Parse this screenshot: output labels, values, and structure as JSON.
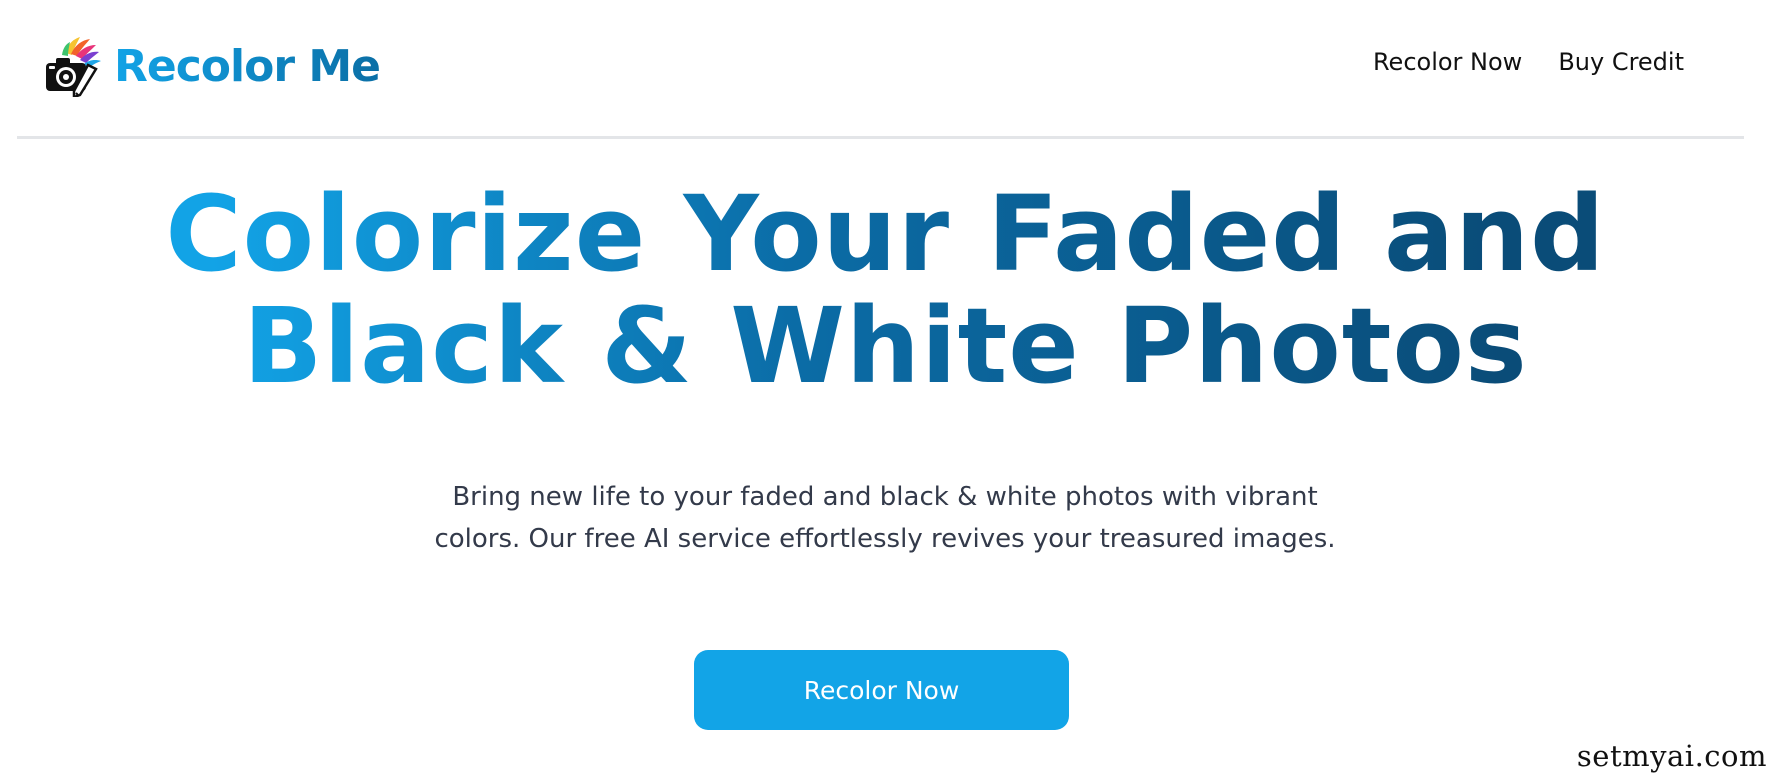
{
  "brand": {
    "name": "Recolor Me",
    "logo_icon": "camera-paint-icon"
  },
  "nav": {
    "items": [
      {
        "label": "Recolor Now"
      },
      {
        "label": "Buy Credit"
      }
    ]
  },
  "hero": {
    "title_line1": "Colorize Your Faded and",
    "title_line2": "Black & White Photos",
    "description": "Bring new life to your faded and black & white photos with vibrant colors. Our free AI service effortlessly revives your treasured images.",
    "cta_label": "Recolor Now"
  },
  "watermark": "setmyai.com",
  "colors": {
    "brand_light": "#12a3e6",
    "brand_dark": "#0a4c78",
    "cta_background": "#12a4e7",
    "text_body": "#333a4a"
  }
}
